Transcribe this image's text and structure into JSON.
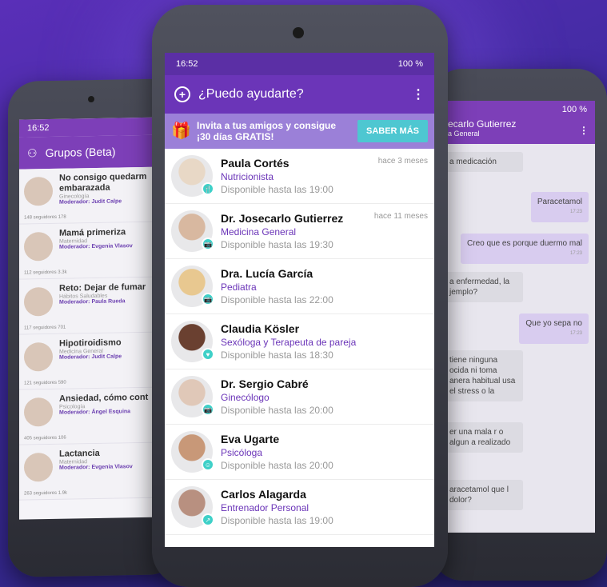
{
  "left_phone": {
    "status_time": "16:52",
    "title": "Grupos (Beta)",
    "groups": [
      {
        "title": "No consigo quedarm embarazada",
        "category": "Ginecología",
        "moderator": "Moderador: Judit Calpe",
        "footer": "148 seguidores  178"
      },
      {
        "title": "Mamá primeriza",
        "category": "Maternidad",
        "moderator": "Moderador: Evgenia Vlasov",
        "footer": "112 seguidores  3.3k"
      },
      {
        "title": "Reto: Dejar de fumar",
        "category": "Hábitos Saludables",
        "moderator": "Moderador: Paula Rueda",
        "footer": "117 seguidores  701"
      },
      {
        "title": "Hipotiroidismo",
        "category": "Medicina General",
        "moderator": "Moderador: Judit Calpe",
        "footer": "121 seguidores  590"
      },
      {
        "title": "Ansiedad, cómo cont",
        "category": "Psicología",
        "moderator": "Moderador: Ángel Esquina",
        "footer": "405 seguidores  106"
      },
      {
        "title": "Lactancia",
        "category": "Maternidad",
        "moderator": "Moderador: Evgenia Vlasov",
        "footer": "263 seguidores  1.9k"
      }
    ]
  },
  "right_phone": {
    "status": "100 %",
    "title": "ecarlo Gutierrez",
    "subtitle": "a General",
    "messages": [
      {
        "dir": "in",
        "text": "a medicación",
        "top": 0
      },
      {
        "dir": "out",
        "text": "Paracetamol",
        "time": "17:23"
      },
      {
        "dir": "out",
        "text": "Creo que es porque duermo mal",
        "time": "17:23"
      },
      {
        "dir": "in",
        "text": "a enfermedad, la jemplo?"
      },
      {
        "dir": "out",
        "text": "Que yo sepa no",
        "time": "17:23"
      },
      {
        "dir": "in",
        "text": "tiene ninguna ocida ni toma anera habitual usa el stress o la"
      },
      {
        "dir": "in",
        "text": "er una mala r o algun a realizado"
      },
      {
        "dir": "in",
        "text": "aracetamol que l dolor?"
      }
    ]
  },
  "center_phone": {
    "status_time": "16:52",
    "status_right": "100 %",
    "title": "¿Puedo ayudarte?",
    "promo_line1": "Invita a tus amigos y consigue",
    "promo_line2": "¡30 días GRATIS!",
    "promo_button": "SABER MÁS",
    "doctors": [
      {
        "name": "Paula Cortés",
        "specialty": "Nutricionista",
        "availability": "Disponible hasta las 19:00",
        "ago": "hace 3 meses",
        "badge": "🍴",
        "color": "#e8d8c6"
      },
      {
        "name": "Dr. Josecarlo Gutierrez",
        "specialty": "Medicina General",
        "availability": "Disponible hasta las 19:30",
        "ago": "hace 11 meses",
        "badge": "📷",
        "color": "#d8b8a0"
      },
      {
        "name": "Dra. Lucía García",
        "specialty": "Pediatra",
        "availability": "Disponible hasta las 22:00",
        "ago": "",
        "badge": "📷",
        "color": "#e8c890"
      },
      {
        "name": "Claudia Kösler",
        "specialty": "Sexóloga y Terapeuta de pareja",
        "availability": "Disponible hasta las 18:30",
        "ago": "",
        "badge": "♥",
        "color": "#6a4030"
      },
      {
        "name": "Dr. Sergio Cabré",
        "specialty": "Ginecólogo",
        "availability": "Disponible hasta las 20:00",
        "ago": "",
        "badge": "📷",
        "color": "#e0c8b8"
      },
      {
        "name": "Eva Ugarte",
        "specialty": "Psicóloga",
        "availability": "Disponible hasta las 20:00",
        "ago": "",
        "badge": "☺",
        "color": "#c89878"
      },
      {
        "name": "Carlos Alagarda",
        "specialty": "Entrenador Personal",
        "availability": "Disponible hasta las 19:00",
        "ago": "",
        "badge": "↗",
        "color": "#b89080"
      }
    ]
  }
}
